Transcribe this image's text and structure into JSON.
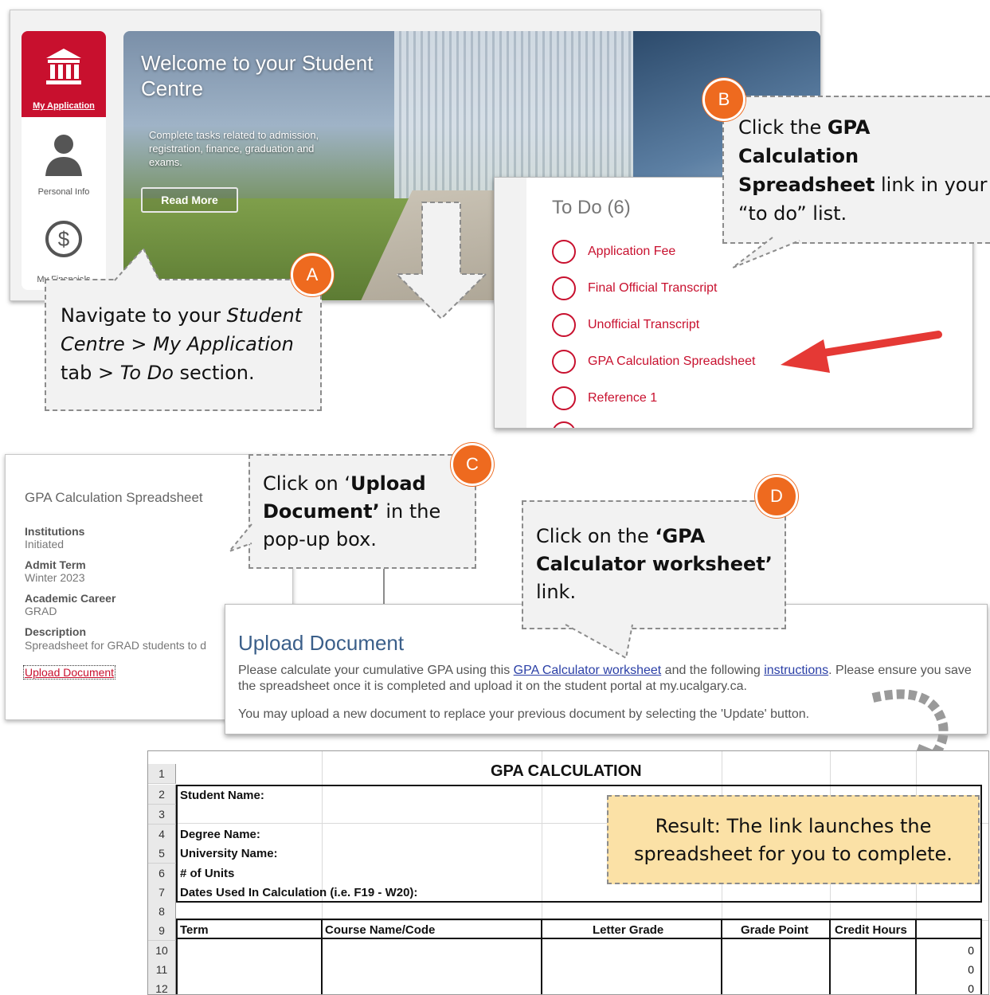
{
  "student_centre": {
    "sidebar": {
      "my_application": "My Application",
      "personal_info": "Personal Info",
      "my_financials": "My Financials"
    },
    "hero": {
      "title": "Welcome to your Student Centre",
      "description": "Complete tasks related to admission, registration, finance, graduation and exams.",
      "read_more": "Read More"
    }
  },
  "todo": {
    "title": "To Do (6)",
    "items": [
      {
        "label": "Application Fee"
      },
      {
        "label": "Final Official Transcript"
      },
      {
        "label": "Unofficial Transcript"
      },
      {
        "label": "GPA Calculation Spreadsheet"
      },
      {
        "label": "Reference 1"
      }
    ]
  },
  "gpa_detail": {
    "title": "GPA Calculation Spreadsheet",
    "fields": [
      {
        "label": "Institutions",
        "value": "Initiated"
      },
      {
        "label": "Admit Term",
        "value": "Winter 2023"
      },
      {
        "label": "Academic Career",
        "value": "GRAD"
      },
      {
        "label": "Description",
        "value": "Spreadsheet for GRAD students to d"
      }
    ],
    "link": "Upload Document"
  },
  "upload": {
    "title": "Upload Document",
    "text_before": "Please calculate your cumulative GPA using this ",
    "worksheet_link": "GPA Calculator worksheet",
    "text_middle": " and the following ",
    "instructions_link": "instructions",
    "text_after": ". Please ensure you save the spreadsheet once it is completed and upload it on the student portal at my.ucalgary.ca.",
    "update_note": "You may upload a new document to replace your previous document by selecting the 'Update' button."
  },
  "spreadsheet": {
    "title": "GPA CALCULATION",
    "row_numbers": [
      "1",
      "2",
      "3",
      "4",
      "5",
      "6",
      "7",
      "8",
      "9",
      "10",
      "11",
      "12"
    ],
    "labels": {
      "student_name": "Student Name:",
      "degree_name": "Degree Name:",
      "university_name": "University Name:",
      "units": "# of Units",
      "dates": "Dates Used In Calculation (i.e. F19 - W20):"
    },
    "headers": [
      "Term",
      "Course Name/Code",
      "Letter Grade",
      "Grade Point",
      "Credit Hours"
    ],
    "zero_values": [
      "0",
      "0",
      "0"
    ]
  },
  "callouts": {
    "a": {
      "badge": "A",
      "line1": "Navigate to your ",
      "line1_em": "Student",
      "line2_em": "Centre > My Application",
      "line3_pre": "tab  > ",
      "line3_em": "To Do",
      "line3_post": " section."
    },
    "b": {
      "badge": "B",
      "pre": "Click the ",
      "bold": "GPA Calculation Spreadsheet",
      "post": "link in your “to do” list."
    },
    "c": {
      "badge": "C",
      "pre": "Click on ‘",
      "bold": "Upload Document’",
      "post": " in the pop-up box."
    },
    "d": {
      "badge": "D",
      "pre": "Click on the ",
      "bold": "‘GPA Calculator worksheet’",
      "post": "link."
    },
    "result": "Result: The link launches the spreadsheet for you to complete."
  },
  "colors": {
    "brand_red": "#c8102e",
    "badge_orange": "#ee6a1f",
    "link_blue": "#2a3fa6",
    "result_bg": "#fbe1a6"
  }
}
